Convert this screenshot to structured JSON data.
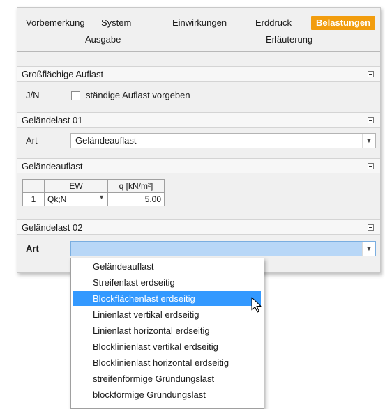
{
  "tabs": [
    {
      "label": "Vorbemerkung",
      "active": false
    },
    {
      "label": "System",
      "active": false
    },
    {
      "label": "Einwirkungen",
      "active": false
    },
    {
      "label": "Erddruck",
      "active": false
    },
    {
      "label": "Belastungen",
      "active": true
    },
    {
      "label": "Ausgabe",
      "active": false
    },
    {
      "label": "Erläuterung",
      "active": false
    }
  ],
  "sections": {
    "grossflaechige": {
      "title": "Großflächige Auflast",
      "row_label": "J/N",
      "checkbox_label": "ständige Auflast vorgeben",
      "checked": false
    },
    "gelaendelast01": {
      "title": "Geländelast 01",
      "art_label": "Art",
      "art_value": "Geländeauflast"
    },
    "gelaendeauflast": {
      "title": "Geländeauflast",
      "columns": [
        "EW",
        "q [kN/m²]"
      ],
      "rows": [
        {
          "index": "1",
          "ew": "Qk;N",
          "q": "5.00"
        }
      ]
    },
    "gelaendelast02": {
      "title": "Geländelast 02",
      "art_label": "Art",
      "art_value": ""
    }
  },
  "dropdown": {
    "options": [
      "Geländeauflast",
      "Streifenlast erdseitig",
      "Blockflächenlast erdseitig",
      "Linienlast vertikal erdseitig",
      "Linienlast horizontal erdseitig",
      "Blocklinienlast vertikal erdseitig",
      "Blocklinienlast horizontal erdseitig",
      "streifenförmige Gründungslast",
      "blockförmige Gründungslast"
    ],
    "highlighted_index": 2
  },
  "colors": {
    "accent": "#f29d0e",
    "selection": "#3399ff",
    "select_active": "#b8d7f7"
  }
}
